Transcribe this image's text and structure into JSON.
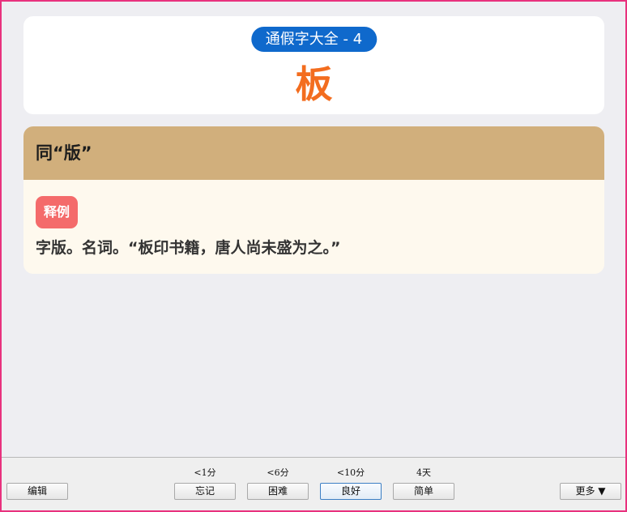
{
  "card": {
    "deck_label": "通假字大全 - 4",
    "word": "板",
    "definition": "同“版”",
    "tag_label": "释例",
    "example": "字版。名词。“板印书籍，唐人尚未盛为之。”"
  },
  "colors": {
    "deck_badge": "#0f69cc",
    "word": "#f36d1f",
    "definition_header": "#d1af7c",
    "definition_body": "#fef9ee",
    "tag": "#f46b6b",
    "frame": "#e8317e"
  },
  "toolbar": {
    "edit_label": "编辑",
    "more_label": "更多 ▼",
    "answers": [
      {
        "label": "忘记",
        "interval": "<1分"
      },
      {
        "label": "困难",
        "interval": "<6分"
      },
      {
        "label": "良好",
        "interval": "<10分"
      },
      {
        "label": "简单",
        "interval": "4天"
      }
    ]
  }
}
